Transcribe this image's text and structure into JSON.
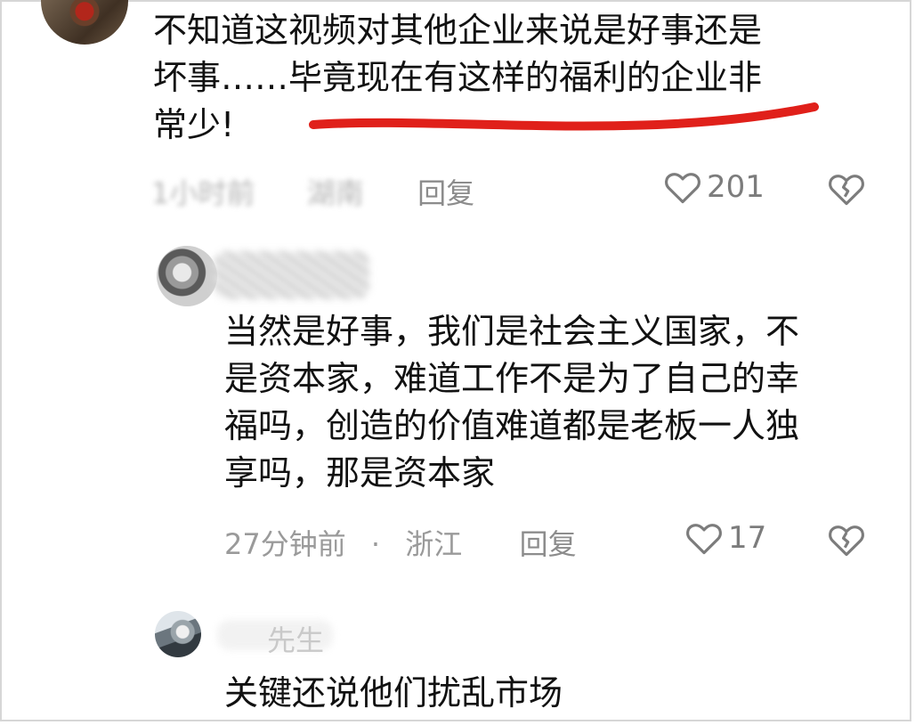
{
  "top_comment": {
    "text": "不知道这视频对其他企业来说是好事还是\n坏事……毕竟现在有这样的福利的企业非\n常少!",
    "time": "1小时前",
    "location": "湖南",
    "reply_label": "回复",
    "likes": "201",
    "highlight_color": "#e0201a"
  },
  "reply1": {
    "text": "当然是好事，我们是社会主义国家，不\n是资本家，难道工作不是为了自己的幸\n福吗，创造的价值难道都是老板一人独\n享吗，那是资本家",
    "time": "27分钟前",
    "separator": "·",
    "location": "浙江",
    "reply_label": "回复",
    "likes": "17"
  },
  "reply2": {
    "name_fragment": "先生",
    "text": "关键还说他们扰乱市场"
  }
}
